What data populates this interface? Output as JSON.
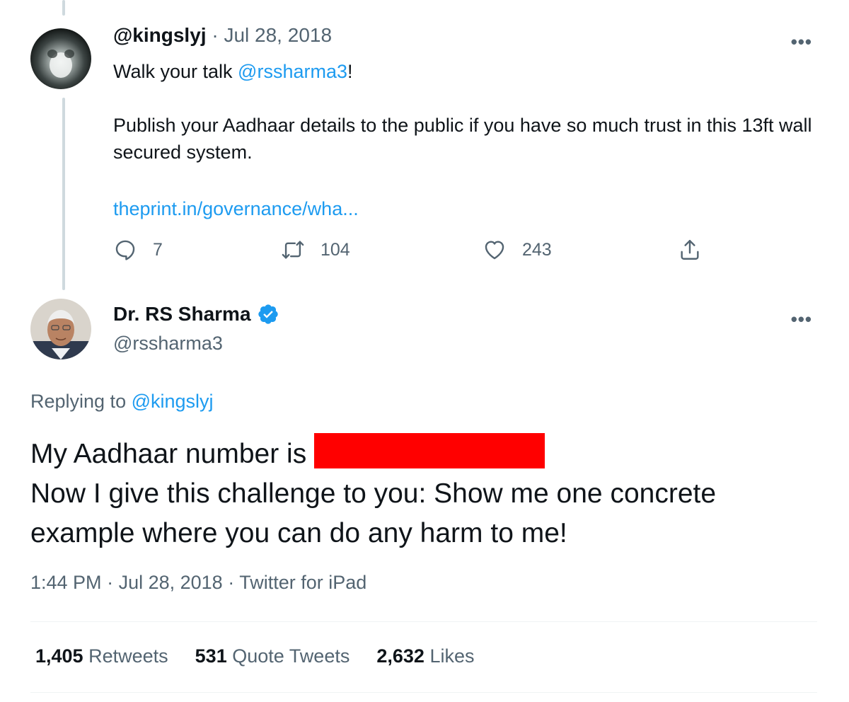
{
  "reply_to_tweet": {
    "handle": "@kingslyj",
    "separator": "·",
    "date": "Jul 28, 2018",
    "text_before_mention": "Walk your talk ",
    "mention": "@rssharma3",
    "text_after_mention": "!",
    "paragraph2": "Publish your Aadhaar details to the public if you have so much trust in this 13ft wall secured system.",
    "link": "theprint.in/governance/wha...",
    "more": "•••",
    "actions": {
      "reply_count": "7",
      "retweet_count": "104",
      "like_count": "243"
    },
    "icons": {
      "reply": "reply-icon",
      "retweet": "retweet-icon",
      "like": "heart-icon",
      "share": "share-icon"
    }
  },
  "main_tweet": {
    "name": "Dr. RS Sharma",
    "handle": "@rssharma3",
    "more": "•••",
    "replying_prefix": "Replying to ",
    "replying_handle": "@kingslyj",
    "line1": "My Aadhaar number is ",
    "line2": "Now I give this challenge to you: Show me one concrete example where you can do any harm to me!",
    "time": "1:44 PM",
    "date": "Jul 28, 2018",
    "source": "Twitter for iPad",
    "stats": {
      "retweets_count": "1,405",
      "retweets_label": "Retweets",
      "quotes_count": "531",
      "quotes_label": "Quote Tweets",
      "likes_count": "2,632",
      "likes_label": "Likes"
    }
  },
  "colors": {
    "link": "#1d9bf0",
    "muted": "#536471",
    "text": "#0f1419",
    "redaction": "#ff0000",
    "verified": "#1d9bf0"
  }
}
